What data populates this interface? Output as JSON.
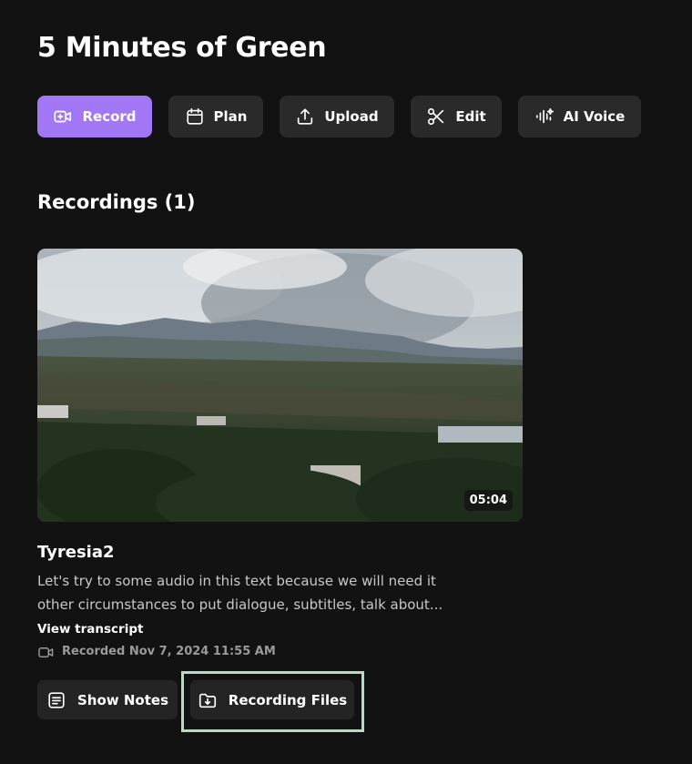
{
  "page": {
    "title": "5 Minutes of Green"
  },
  "toolbar": {
    "record_label": "Record",
    "plan_label": "Plan",
    "upload_label": "Upload",
    "edit_label": "Edit",
    "ai_voice_label": "AI Voice"
  },
  "recordings": {
    "heading": "Recordings (1)",
    "items": [
      {
        "title": "Tyresia2",
        "duration": "05:04",
        "description": "Let's try to some audio in this text because we will need it other circumstances to put dialogue, subtitles, talk about...",
        "view_transcript_label": "View transcript",
        "recorded_label": "Recorded Nov 7, 2024 11:55 AM",
        "show_notes_label": "Show Notes",
        "recording_files_label": "Recording Files"
      }
    ]
  },
  "colors": {
    "background": "#121212",
    "accent": "#a177f5",
    "button_bg": "#2a2a2a",
    "highlight_border": "#b5dcbf"
  },
  "icons": {
    "record": "video-plus-icon",
    "plan": "calendar-icon",
    "upload": "upload-icon",
    "edit": "scissors-icon",
    "ai_voice": "audio-sparkle-icon",
    "meta": "video-camera-icon",
    "show_notes": "notes-icon",
    "recording_files": "folder-download-icon"
  }
}
